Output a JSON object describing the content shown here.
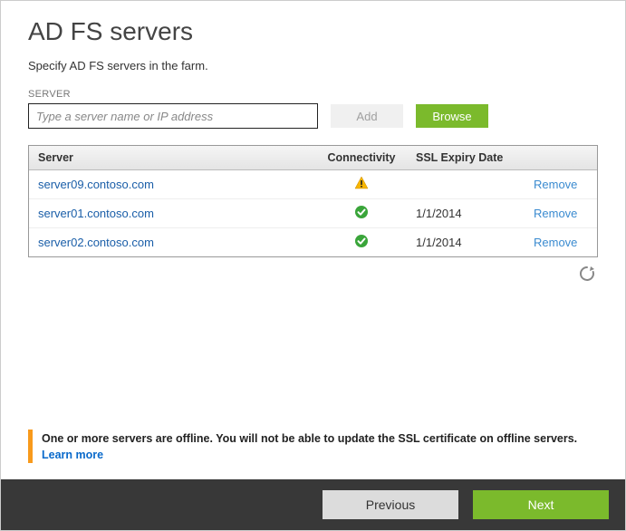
{
  "page": {
    "title": "AD FS servers",
    "subtitle": "Specify AD FS servers in the farm."
  },
  "serverInput": {
    "label": "SERVER",
    "placeholder": "Type a server name or IP address",
    "addLabel": "Add",
    "browseLabel": "Browse"
  },
  "table": {
    "headers": {
      "server": "Server",
      "connectivity": "Connectivity",
      "sslExpiry": "SSL Expiry Date"
    },
    "rows": [
      {
        "server": "server09.contoso.com",
        "status": "warning",
        "sslExpiry": "",
        "action": "Remove"
      },
      {
        "server": "server01.contoso.com",
        "status": "ok",
        "sslExpiry": "1/1/2014",
        "action": "Remove"
      },
      {
        "server": "server02.contoso.com",
        "status": "ok",
        "sslExpiry": "1/1/2014",
        "action": "Remove"
      }
    ]
  },
  "alert": {
    "message": "One or more servers are offline. You will not be able to update the SSL certificate on offline servers.",
    "learnMore": "Learn more"
  },
  "footer": {
    "previous": "Previous",
    "next": "Next"
  }
}
